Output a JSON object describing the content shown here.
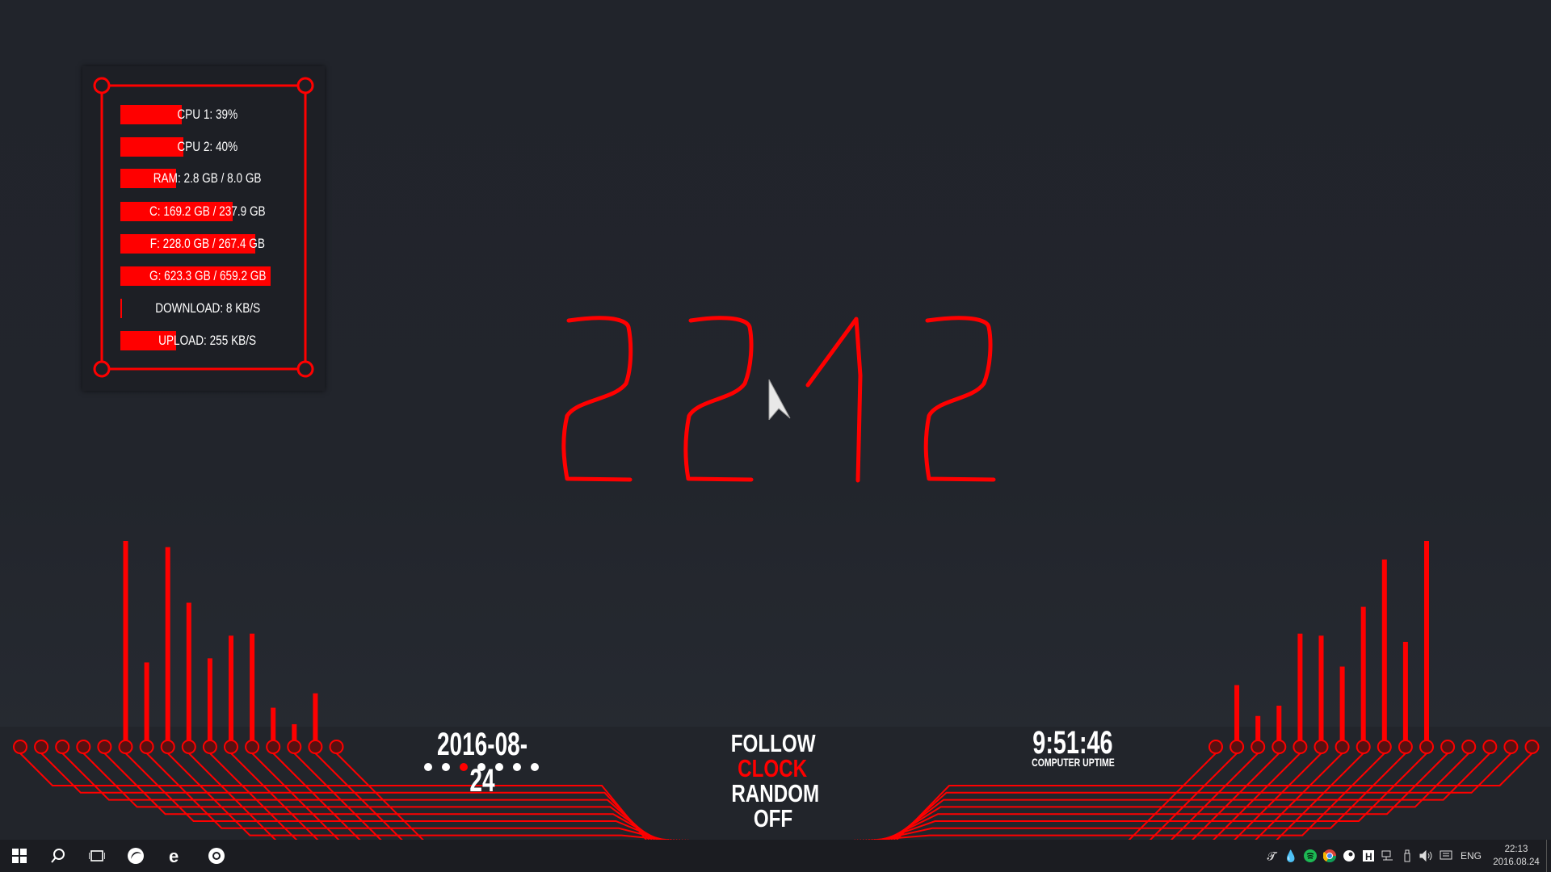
{
  "monitor": {
    "meters": [
      {
        "label": "CPU 1: 39%",
        "fill": 0.39
      },
      {
        "label": "CPU 2: 40%",
        "fill": 0.4
      },
      {
        "label": "RAM: 2.8 GB / 8.0 GB",
        "fill": 0.35
      },
      {
        "label": "C: 169.2 GB / 237.9 GB",
        "fill": 0.71
      },
      {
        "label": "F: 228.0 GB / 267.4 GB",
        "fill": 0.85
      },
      {
        "label": "G: 623.3 GB / 659.2 GB",
        "fill": 0.95
      },
      {
        "label": "DOWNLOAD: 8 KB/S",
        "fill": 0.01
      },
      {
        "label": "UPLOAD: 255 KB/S",
        "fill": 0.35
      }
    ]
  },
  "clock": {
    "time": "2212"
  },
  "date": {
    "value": "2016-08-24",
    "active_dot": 3,
    "dot_count": 7
  },
  "follow": {
    "lines": [
      "FOLLOW",
      "CLOCK",
      "RANDOM",
      "OFF"
    ],
    "highlight_index": 1
  },
  "uptime": {
    "value": "9:51:46",
    "label": "COMPUTER UPTIME"
  },
  "visualizer": {
    "left_levels": [
      0,
      0,
      0,
      0,
      0,
      1.0,
      0.41,
      0.97,
      0.7,
      0.43,
      0.54,
      0.55,
      0.19,
      0.11,
      0.26,
      0
    ],
    "right_levels": [
      0,
      0.3,
      0.15,
      0.2,
      0.55,
      0.54,
      0.39,
      0.68,
      0.91,
      0.51,
      1.0,
      0,
      0,
      0,
      0,
      0
    ]
  },
  "colors": {
    "accent": "#ff0000",
    "background": "#22252b",
    "taskbar": "#1b1c21"
  },
  "taskbar": {
    "apps": [
      "start-icon",
      "search-icon",
      "task-view-icon",
      "firefox-icon",
      "edge-icon",
      "chrome-icon"
    ],
    "tray_icons": [
      "font-icon",
      "drop-icon",
      "spotify-icon",
      "chrome-tray-icon",
      "steam-icon",
      "h-icon",
      "network-icon",
      "usb-icon",
      "volume-icon",
      "notification-icon"
    ],
    "language": "ENG",
    "time": "22:13",
    "date": "2016.08.24"
  }
}
